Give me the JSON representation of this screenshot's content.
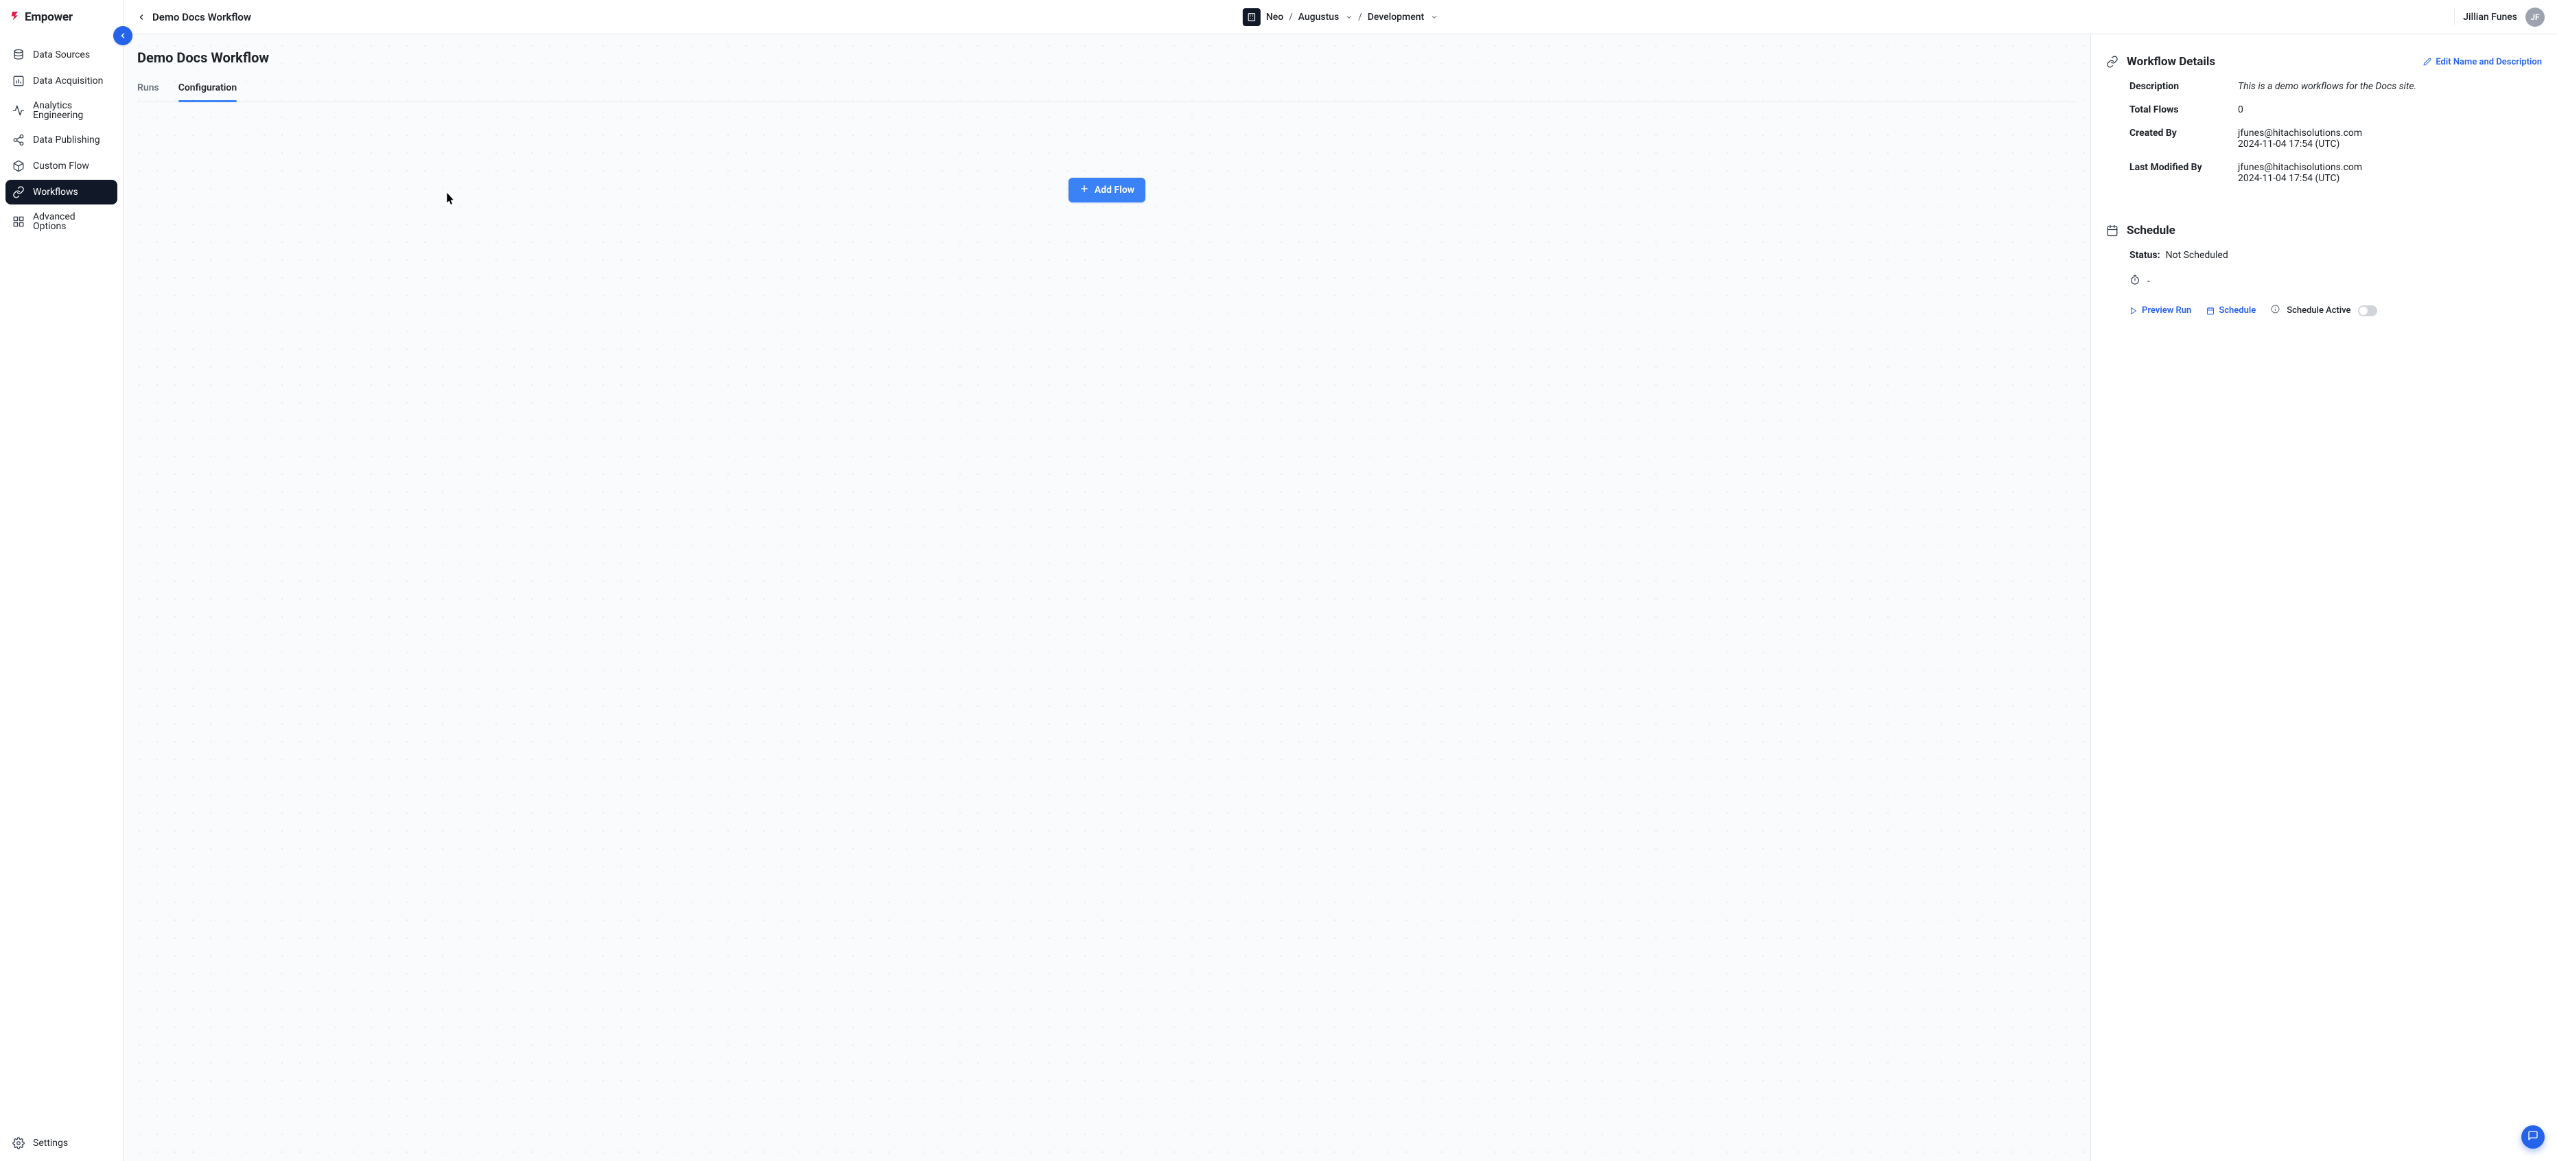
{
  "app": {
    "name": "Empower"
  },
  "header": {
    "breadcrumb_title": "Demo Docs Workflow",
    "org": "Neo",
    "project": "Augustus",
    "env": "Development",
    "user_name": "Jillian Funes",
    "user_initials": "JF"
  },
  "sidebar": {
    "items": [
      {
        "label": "Data Sources"
      },
      {
        "label": "Data Acquisition"
      },
      {
        "label": "Analytics Engineering"
      },
      {
        "label": "Data Publishing"
      },
      {
        "label": "Custom Flow"
      },
      {
        "label": "Workflows"
      },
      {
        "label": "Advanced Options"
      }
    ],
    "settings_label": "Settings"
  },
  "page": {
    "title": "Demo Docs Workflow",
    "tabs": {
      "runs": "Runs",
      "configuration": "Configuration"
    },
    "add_flow_label": "Add Flow"
  },
  "details": {
    "title": "Workflow Details",
    "edit_label": "Edit Name and Description",
    "fields": {
      "description_label": "Description",
      "description_value": "This is a demo workflows for the Docs site.",
      "total_flows_label": "Total Flows",
      "total_flows_value": "0",
      "created_by_label": "Created By",
      "created_by_user": "jfunes@hitachisolutions.com",
      "created_by_time": "2024-11-04 17:54 (UTC)",
      "modified_by_label": "Last Modified By",
      "modified_by_user": "jfunes@hitachisolutions.com",
      "modified_by_time": "2024-11-04 17:54 (UTC)"
    }
  },
  "schedule": {
    "title": "Schedule",
    "status_label": "Status:",
    "status_value": "Not Scheduled",
    "cron_display": "-",
    "preview_run_label": "Preview Run",
    "schedule_label": "Schedule",
    "schedule_active_label": "Schedule Active"
  }
}
